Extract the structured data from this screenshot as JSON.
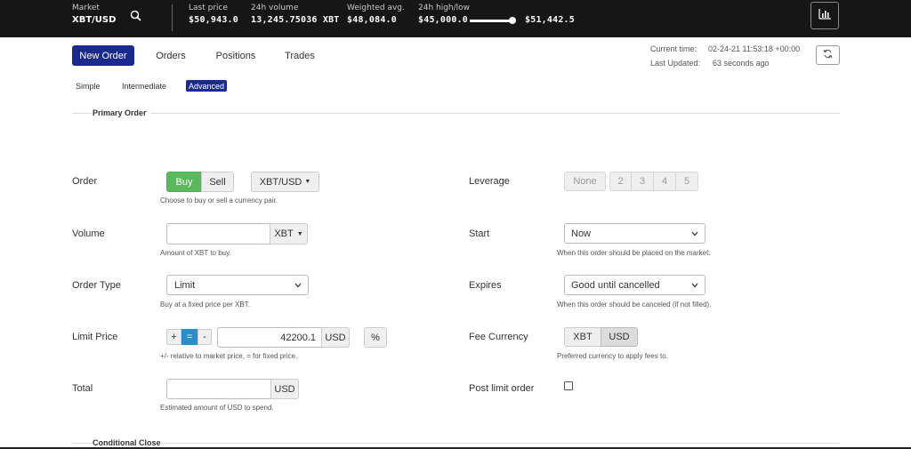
{
  "topbar": {
    "market_label": "Market",
    "market_pair": "XBT/USD",
    "last_price_label": "Last price",
    "last_price": "$50,943.0",
    "volume_label": "24h volume",
    "volume": "13,245.75036 XBT",
    "weighted_label": "Weighted avg.",
    "weighted": "$48,084.0",
    "highlow_label": "24h high/low",
    "low": "$45,000.0",
    "high": "$51,442.5",
    "range_position": 0.92
  },
  "nav": {
    "tabs": [
      "New Order",
      "Orders",
      "Positions",
      "Trades"
    ],
    "active_tab": "New Order"
  },
  "status": {
    "current_time_label": "Current time:",
    "current_time": "02-24-21 11:53:18 +00:00",
    "last_updated_label": "Last Updated:",
    "last_updated": "63 seconds ago"
  },
  "order_modes": [
    "Simple",
    "Intermediate",
    "Advanced"
  ],
  "active_mode": "Advanced",
  "primary_order": {
    "title": "Primary Order",
    "order": {
      "label": "Order",
      "buy": "Buy",
      "sell": "Sell",
      "pair": "XBT/USD",
      "help": "Choose to buy or sell a currency pair."
    },
    "volume": {
      "label": "Volume",
      "value": "",
      "currency": "XBT",
      "help": "Amount of XBT to buy."
    },
    "order_type": {
      "label": "Order Type",
      "value": "Limit",
      "help": "Buy at a fixed price per XBT."
    },
    "limit_price": {
      "label": "Limit Price",
      "plus": "+",
      "equals": "=",
      "minus": "-",
      "value": "42200.1",
      "currency": "USD",
      "percent": "%",
      "help": "+/- relative to market price, = for fixed price."
    },
    "total": {
      "label": "Total",
      "value": "",
      "currency": "USD",
      "help": "Estimated amount of USD to spend."
    },
    "leverage": {
      "label": "Leverage",
      "options": [
        "None",
        "2",
        "3",
        "4",
        "5"
      ]
    },
    "start": {
      "label": "Start",
      "value": "Now",
      "help": "When this order should be placed on the market."
    },
    "expires": {
      "label": "Expires",
      "value": "Good until cancelled",
      "help": "When this order should be canceled (if not filled)."
    },
    "fee_currency": {
      "label": "Fee Currency",
      "options": [
        "XBT",
        "USD"
      ],
      "selected": "USD",
      "help": "Preferred currency to apply fees to."
    },
    "post_limit": {
      "label": "Post limit order",
      "checked": false
    }
  },
  "conditional_close": {
    "title": "Conditional Close"
  },
  "icons": {
    "search": "search-icon",
    "chart": "bar-chart-icon",
    "refresh": "refresh-icon",
    "dropdown": "chevron-down-icon"
  },
  "colors": {
    "topbar_bg": "#161616",
    "accent": "#1b2a8f",
    "buy_green": "#5cb85c",
    "equals_blue": "#2a8cc8"
  }
}
